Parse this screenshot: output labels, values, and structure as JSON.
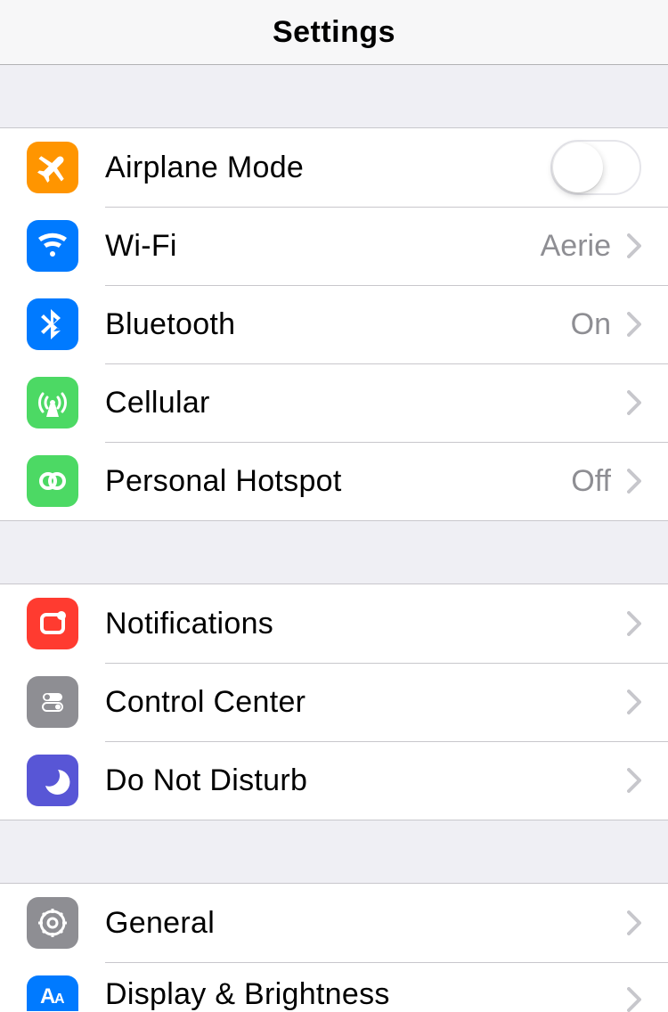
{
  "header": {
    "title": "Settings"
  },
  "groups": [
    {
      "rows": [
        {
          "label": "Airplane Mode",
          "toggle": false
        },
        {
          "label": "Wi-Fi",
          "value": "Aerie"
        },
        {
          "label": "Bluetooth",
          "value": "On"
        },
        {
          "label": "Cellular"
        },
        {
          "label": "Personal Hotspot",
          "value": "Off"
        }
      ]
    },
    {
      "rows": [
        {
          "label": "Notifications"
        },
        {
          "label": "Control Center"
        },
        {
          "label": "Do Not Disturb"
        }
      ]
    },
    {
      "rows": [
        {
          "label": "General"
        },
        {
          "label": "Display & Brightness"
        }
      ]
    }
  ]
}
